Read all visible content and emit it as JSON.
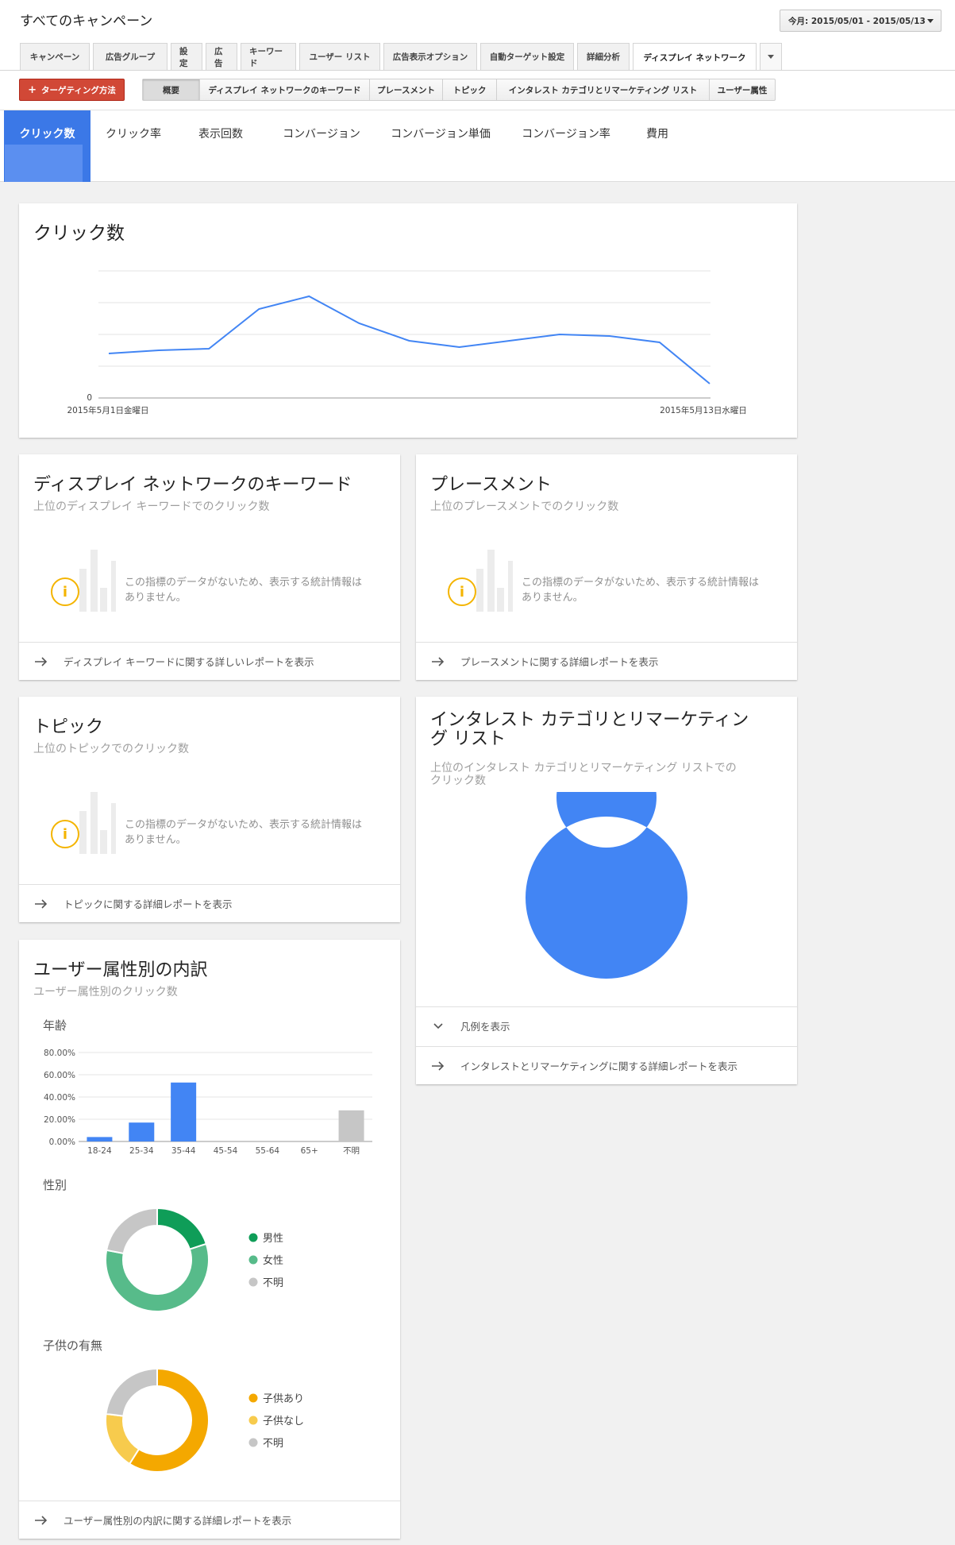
{
  "header": {
    "title": "すべてのキャンペーン",
    "date_range": "今月: 2015/05/01 - 2015/05/13"
  },
  "tabs": [
    "キャンペーン",
    "広告グループ",
    "設定",
    "広告",
    "キーワード",
    "ユーザー リスト",
    "広告表示オプション",
    "自動ターゲット設定",
    "詳細分析",
    "ディスプレイ ネットワーク"
  ],
  "active_tab": "ディスプレイ ネットワーク",
  "targeting_button": "ターゲティング方法",
  "subtabs": [
    "概要",
    "ディスプレイ ネットワークのキーワード",
    "プレースメント",
    "トピック",
    "インタレスト カテゴリとリマーケティング リスト",
    "ユーザー属性"
  ],
  "metrics": [
    "クリック数",
    "クリック率",
    "表示回数",
    "コンバージョン",
    "コンバージョン単価",
    "コンバージョン率",
    "費用"
  ],
  "clicks_card": {
    "title": "クリック数",
    "y_zero_label": "0",
    "x_start_label": "2015年5月1日金曜日",
    "x_end_label": "2015年5月13日水曜日"
  },
  "keywords_card": {
    "title": "ディスプレイ ネットワークのキーワード",
    "subtitle": "上位のディスプレイ キーワードでのクリック数",
    "nodata": "この指標のデータがないため、表示する統計情報はありません。",
    "footer": "ディスプレイ キーワードに関する詳しいレポートを表示"
  },
  "placements_card": {
    "title": "プレースメント",
    "subtitle": "上位のプレースメントでのクリック数",
    "nodata": "この指標のデータがないため、表示する統計情報はありません。",
    "footer": "プレースメントに関する詳細レポートを表示"
  },
  "topics_card": {
    "title": "トピック",
    "subtitle": "上位のトピックでのクリック数",
    "nodata": "この指標のデータがないため、表示する統計情報はありません。",
    "footer": "トピックに関する詳細レポートを表示"
  },
  "interest_card": {
    "title_line1": "インタレスト カテゴリとリマーケティン",
    "title_line2": "グ リスト",
    "subtitle_line1": "上位のインタレスト カテゴリとリマーケティング リストでの",
    "subtitle_line2": "クリック数",
    "legend_toggle": "凡例を表示",
    "footer": "インタレストとリマーケティングに関する詳細レポートを表示"
  },
  "demographics_card": {
    "title": "ユーザー属性別の内訳",
    "subtitle": "ユーザー属性別のクリック数",
    "age_label": "年齢",
    "gender_label": "性別",
    "children_label": "子供の有無",
    "footer": "ユーザー属性別の内訳に関する詳細レポートを表示"
  },
  "colors": {
    "blue": "#4285f4",
    "gray": "#c6c6c6",
    "male": "#0f9d58",
    "female": "#57bb8a",
    "kids_yes": "#f4a800",
    "kids_no": "#f7cb4d"
  },
  "chart_data": [
    {
      "type": "line",
      "name": "clicks",
      "x": [
        "5/1",
        "5/2",
        "5/3",
        "5/4",
        "5/5",
        "5/6",
        "5/7",
        "5/8",
        "5/9",
        "5/10",
        "5/11",
        "5/12",
        "5/13"
      ],
      "values": [
        1.4,
        1.5,
        1.55,
        2.8,
        3.2,
        2.35,
        1.8,
        1.6,
        1.8,
        2.0,
        1.95,
        1.75,
        0.45
      ],
      "ylim": [
        0,
        4
      ],
      "grid": true
    },
    {
      "type": "bar",
      "name": "age",
      "categories": [
        "18-24",
        "25-34",
        "35-44",
        "45-54",
        "55-64",
        "65+",
        "不明"
      ],
      "values": [
        4,
        17,
        53,
        0,
        0,
        0,
        28
      ],
      "yticks": [
        "0.00%",
        "20.00%",
        "40.00%",
        "60.00%",
        "80.00%"
      ],
      "ylim": [
        0,
        80
      ]
    },
    {
      "type": "pie",
      "name": "gender",
      "labels": [
        "男性",
        "女性",
        "不明"
      ],
      "values": [
        20,
        58,
        22
      ]
    },
    {
      "type": "pie",
      "name": "children",
      "labels": [
        "子供あり",
        "子供なし",
        "不明"
      ],
      "values": [
        59,
        18,
        23
      ]
    },
    {
      "type": "pie",
      "name": "interest",
      "values": [
        100
      ]
    }
  ]
}
